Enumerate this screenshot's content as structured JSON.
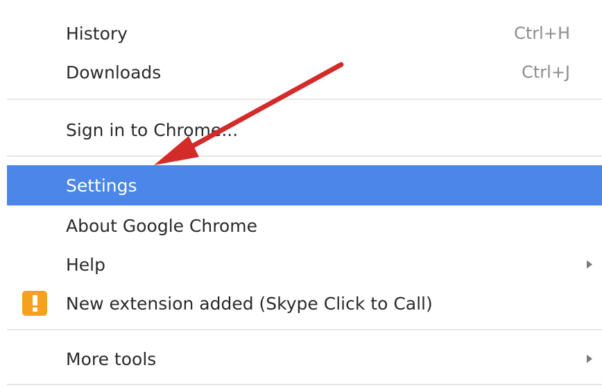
{
  "menu": {
    "items": [
      {
        "label": "History",
        "shortcut": "Ctrl+H"
      },
      {
        "label": "Downloads",
        "shortcut": "Ctrl+J"
      },
      {
        "label": "Sign in to Chrome..."
      },
      {
        "label": "Settings",
        "selected": true
      },
      {
        "label": "About Google Chrome"
      },
      {
        "label": "Help",
        "submenu": true
      },
      {
        "label": "New extension added (Skype Click to Call)",
        "icon": "warning-icon"
      },
      {
        "label": "More tools",
        "submenu": true
      }
    ]
  },
  "colors": {
    "highlight": "#4b86e8",
    "arrow": "#d42a2a",
    "warning": "#f5a11c"
  }
}
